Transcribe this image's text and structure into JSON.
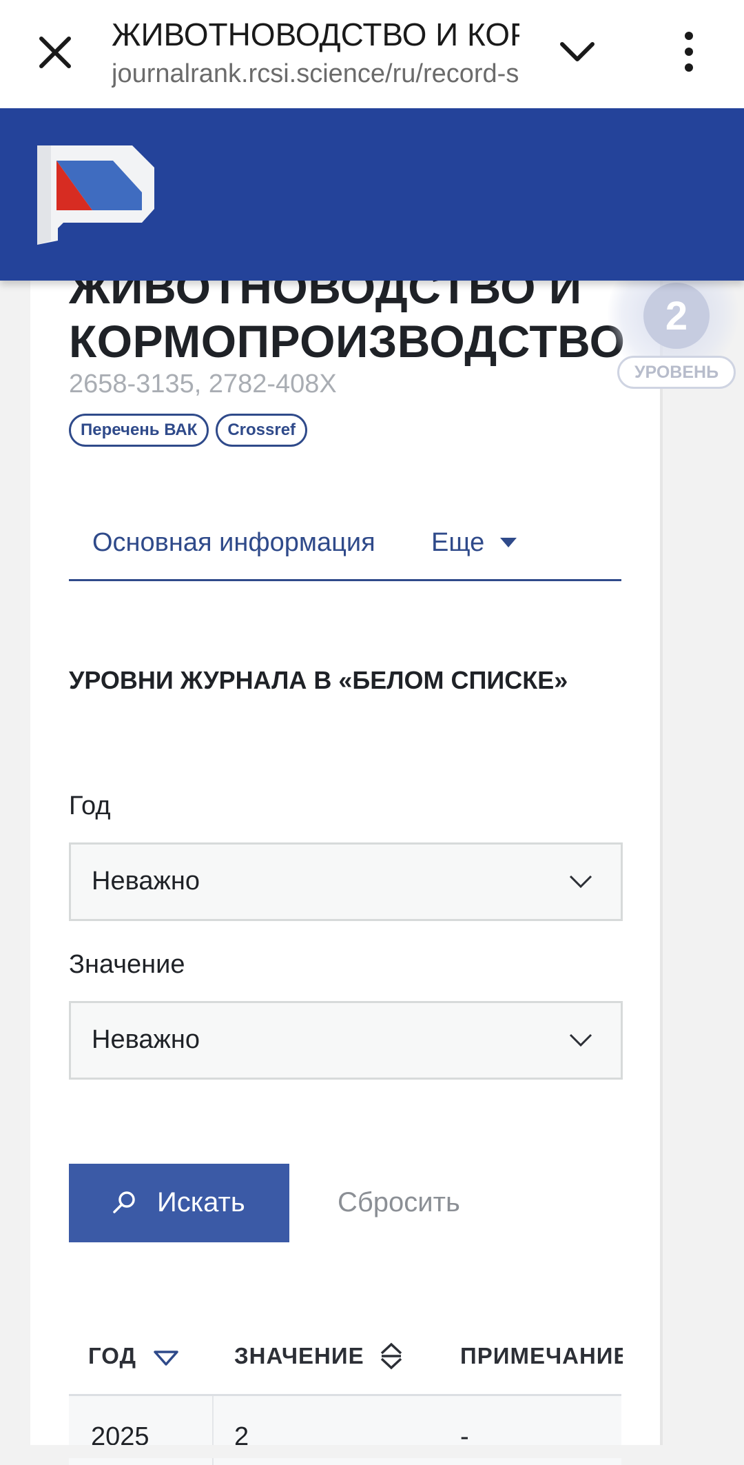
{
  "browser": {
    "page_title": "ЖИВОТНОВОДСТВО И КОРМОПРОИЗВОДСТВО",
    "url": "journalrank.rcsi.science/ru/record-sources/details/"
  },
  "header": {
    "logo_icon": "rcsi-logo-icon",
    "color": "#24439a"
  },
  "journal": {
    "title": "ЖИВОТНОВОДСТВО И КОРМОПРОИЗВОДСТВО",
    "issn": "2658-3135, 2782-408X",
    "tags": [
      "Перечень ВАК",
      "Crossref"
    ],
    "level_value": "2",
    "level_label": "УРОВЕНЬ"
  },
  "tabs": {
    "main": "Основная информация",
    "more": "Еще"
  },
  "section": {
    "title": "УРОВНИ ЖУРНАЛА В «БЕЛОМ СПИСКЕ»"
  },
  "filters": {
    "year_label": "Год",
    "year_value": "Неважно",
    "value_label": "Значение",
    "value_value": "Неважно"
  },
  "buttons": {
    "search": "Искать",
    "reset": "Сбросить"
  },
  "table": {
    "columns": [
      "ГОД",
      "ЗНАЧЕНИЕ",
      "ПРИМЕЧАНИЕ"
    ],
    "rows": [
      {
        "year": "2025",
        "value": "2",
        "note": "-"
      }
    ]
  },
  "colors": {
    "accent": "#2f4a8a",
    "button": "#3b5aa6"
  }
}
